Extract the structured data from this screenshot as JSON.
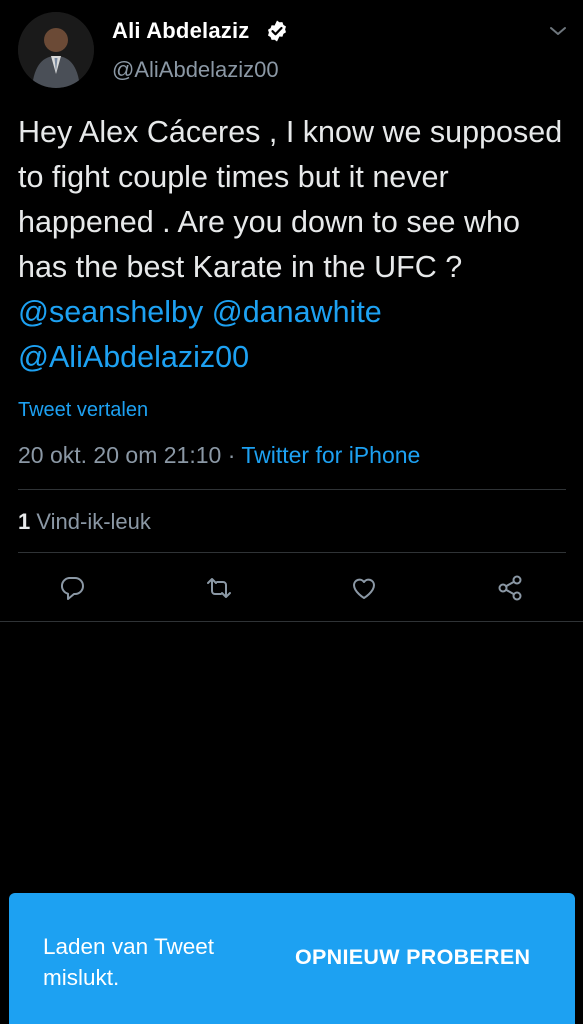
{
  "author": {
    "display_name": "Ali Abdelaziz",
    "handle": "@AliAbdelaziz00",
    "verified": true,
    "avatar_icon": "profile-photo"
  },
  "tweet": {
    "text_plain": "Hey Alex Cáceres , I know we supposed to fight couple times but it never happened . Are you down to see who has the best Karate in the UFC ? ",
    "mention_1": "@seanshelby",
    "mention_2": "@danawhite",
    "mention_3": "@AliAbdelaziz00",
    "translate_label": "Tweet vertalen",
    "timestamp": "20 okt. 20 om 21:10",
    "separator": " · ",
    "source": "Twitter for iPhone"
  },
  "stats": {
    "like_count": "1",
    "like_label": " Vind-ik-leuk"
  },
  "actions": [
    {
      "icon": "reply-icon"
    },
    {
      "icon": "retweet-icon"
    },
    {
      "icon": "like-icon"
    },
    {
      "icon": "share-icon"
    }
  ],
  "snackbar": {
    "message": "Laden van Tweet mislukt.",
    "button_label": "OPNIEUW PROBEREN"
  },
  "colors": {
    "background": "#000000",
    "accent": "#1da1f2",
    "secondary_text": "#8b98a5",
    "divider": "#2f3336"
  }
}
